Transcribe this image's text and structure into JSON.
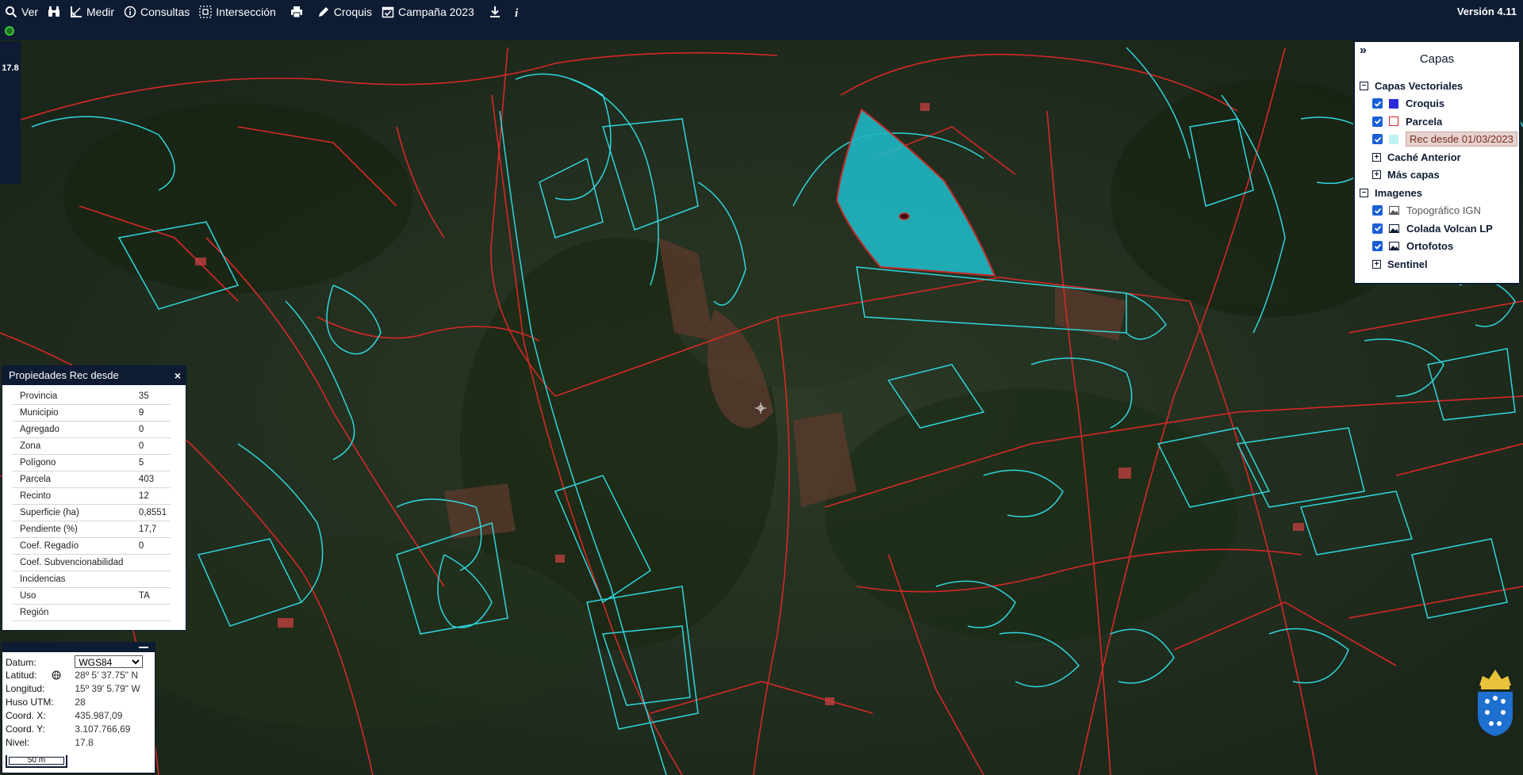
{
  "toolbar": {
    "items": [
      {
        "label": "Ver",
        "icon": "search-icon"
      },
      {
        "label": "",
        "icon": "binoculars-icon"
      },
      {
        "label": "Medir",
        "icon": "ruler-icon"
      },
      {
        "label": "Consultas",
        "icon": "info-circle-icon"
      },
      {
        "label": "Intersección",
        "icon": "intersection-icon"
      },
      {
        "label": "",
        "icon": "print-icon"
      },
      {
        "label": "Croquis",
        "icon": "pencil-icon"
      },
      {
        "label": "Campaña 2023",
        "icon": "calendar-check-icon"
      },
      {
        "label": "",
        "icon": "download-icon"
      },
      {
        "label": "",
        "icon": "info-icon"
      }
    ],
    "version": "Versión 4.11"
  },
  "zoom": {
    "level": "17.8"
  },
  "layers": {
    "title": "Capas",
    "collapse_symbol": "»",
    "groups": [
      {
        "label": "Capas Vectoriales",
        "expanded": true,
        "items": [
          {
            "label": "Croquis",
            "checked": true,
            "swatch": "#2b2bdc"
          },
          {
            "label": "Parcela",
            "checked": true,
            "swatch": "#d32222"
          },
          {
            "label": "Rec desde 01/03/2023",
            "checked": true,
            "swatch": "#bff2f2"
          }
        ]
      },
      {
        "label": "Caché Anterior",
        "expanded": false
      },
      {
        "label": "Más capas",
        "expanded": false
      },
      {
        "label": "Imagenes",
        "expanded": true,
        "items": [
          {
            "label": "Topográfico IGN",
            "checked": true
          },
          {
            "label": "Colada Volcan LP",
            "checked": true
          },
          {
            "label": "Ortofotos",
            "checked": true
          }
        ]
      },
      {
        "label": "Sentinel",
        "expanded": false
      }
    ]
  },
  "properties": {
    "title": "Propiedades Rec desde",
    "close": "×",
    "rows": [
      {
        "key": "Provincia",
        "value": "35"
      },
      {
        "key": "Municipio",
        "value": "9"
      },
      {
        "key": "Agregado",
        "value": "0"
      },
      {
        "key": "Zona",
        "value": "0"
      },
      {
        "key": "Polígono",
        "value": "5"
      },
      {
        "key": "Parcela",
        "value": "403"
      },
      {
        "key": "Recinto",
        "value": "12"
      },
      {
        "key": "Superficie (ha)",
        "value": "0,8551"
      },
      {
        "key": "Pendiente (%)",
        "value": "17,7"
      },
      {
        "key": "Coef. Regadío",
        "value": "0"
      },
      {
        "key": "Coef. Subvencionabilidad",
        "value": ""
      },
      {
        "key": "Incidencias",
        "value": ""
      },
      {
        "key": "Uso",
        "value": "TA"
      },
      {
        "key": "Región",
        "value": ""
      }
    ]
  },
  "coords": {
    "datum_label": "Datum:",
    "datum_value": "WGS84",
    "lat_label": "Latitud:",
    "lat_value": "28º 5' 37.75\" N",
    "lon_label": "Longitud:",
    "lon_value": "15º 39' 5.79\" W",
    "huso_label": "Huso UTM:",
    "huso_value": "28",
    "x_label": "Coord. X:",
    "x_value": "435.987,09",
    "y_label": "Coord. Y:",
    "y_value": "3.107.766,69",
    "nivel_label": "Nivel:",
    "nivel_value": "17.8",
    "scale": "50 m"
  },
  "colors": {
    "toolbar_bg": "#0d1b33",
    "parcel_line": "#d62828",
    "recinto_line": "#2fd6dc",
    "highlight_fill": "#1fb8c4"
  }
}
